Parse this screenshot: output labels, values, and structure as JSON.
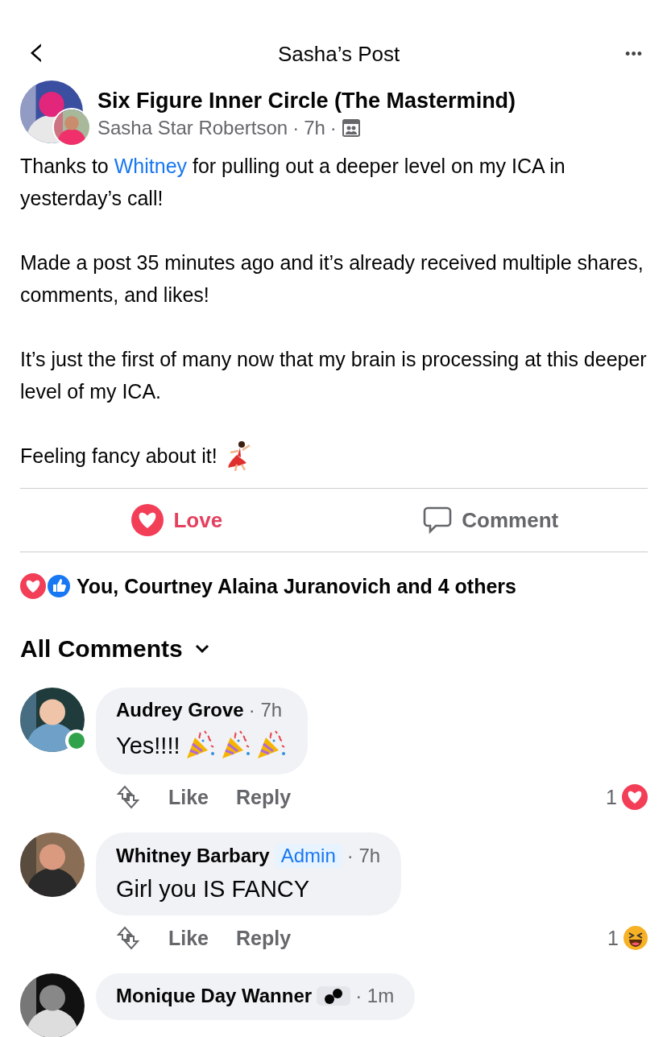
{
  "header": {
    "back": "‹",
    "title": "Sasha’s Post",
    "more": "•••"
  },
  "post": {
    "group": "Six Figure Inner Circle (The Mastermind)",
    "author": "Sasha Star Robertson",
    "time": "7h",
    "separator": "·",
    "paragraphs": [
      [
        {
          "text": "Thanks to ",
          "link": false
        },
        {
          "text": "Whitney",
          "link": true
        },
        {
          "text": " for pulling out a deeper level on my ICA in yesterday’s call!",
          "link": false
        }
      ],
      [
        {
          "text": "Made a post 35 minutes ago and it’s already received multiple shares, comments, and likes!",
          "link": false
        }
      ],
      [
        {
          "text": "It’s just the first of many now that my brain is processing at this deeper level of my ICA.",
          "link": false
        }
      ],
      [
        {
          "text": "Feeling fancy about it!",
          "link": false
        }
      ]
    ],
    "ending_emoji": {
      "kind": "dancer"
    }
  },
  "actions": [
    {
      "label": "Love",
      "kind": "love",
      "selected": true
    },
    {
      "label": "Comment",
      "kind": "comment",
      "selected": false
    }
  ],
  "reactions_summary": "You, Courtney Alaina Juranovich and 4 others",
  "comments_filter": "All Comments",
  "comments": [
    {
      "name": "Audrey Grove",
      "badge_icon": false,
      "time": "· 7h",
      "text": "Yes!!!!",
      "emojis": [
        {
          "kind": "party-popper"
        },
        {
          "kind": "party-popper"
        },
        {
          "kind": "party-popper"
        }
      ],
      "online": true,
      "like": "Like",
      "reply": "Reply",
      "reaction_count": "1",
      "reaction": {
        "kind": "love"
      }
    },
    {
      "name": "Whitney Barbary",
      "badge": "Admin",
      "badge_icon": false,
      "time": "· 7h",
      "text": "Girl you IS FANCY",
      "online": false,
      "like": "Like",
      "reply": "Reply",
      "reaction_count": "1",
      "reaction": {
        "kind": "haha"
      }
    },
    {
      "name": "Monique Day Wanner",
      "badge_icon": true,
      "time": "· 1m",
      "online": false
    }
  ]
}
